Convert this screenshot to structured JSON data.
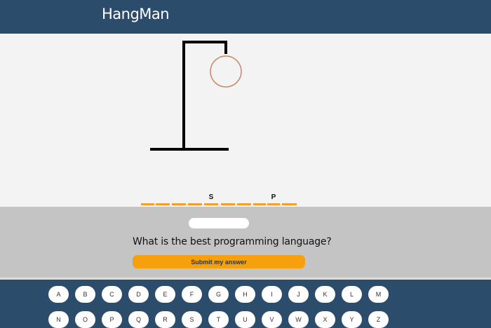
{
  "header": {
    "logo": "HangMan"
  },
  "word": {
    "slots": [
      {
        "letter": ""
      },
      {
        "letter": ""
      },
      {
        "letter": ""
      },
      {
        "letter": ""
      },
      {
        "letter": "S"
      },
      {
        "letter": ""
      },
      {
        "letter": ""
      },
      {
        "letter": ""
      },
      {
        "letter": "P"
      },
      {
        "letter": ""
      }
    ]
  },
  "answer": {
    "value": "",
    "placeholder": ""
  },
  "question": {
    "text": "What is the best programming language?"
  },
  "submit": {
    "label": "Submit my answer"
  },
  "keyboard": {
    "row1": [
      "A",
      "B",
      "C",
      "D",
      "E",
      "F",
      "G",
      "H",
      "I",
      "J",
      "K",
      "L",
      "M"
    ],
    "row2": [
      "N",
      "O",
      "P",
      "Q",
      "R",
      "S",
      "T",
      "U",
      "V",
      "W",
      "X",
      "Y",
      "Z"
    ]
  },
  "colors": {
    "header": "#2c4c6c",
    "stage": "#f3f3f3",
    "slot_underline": "#f2a02a",
    "panel": "#c4c4c4",
    "submit_button": "#f5a00c",
    "rope_head": "#c98a6a"
  }
}
